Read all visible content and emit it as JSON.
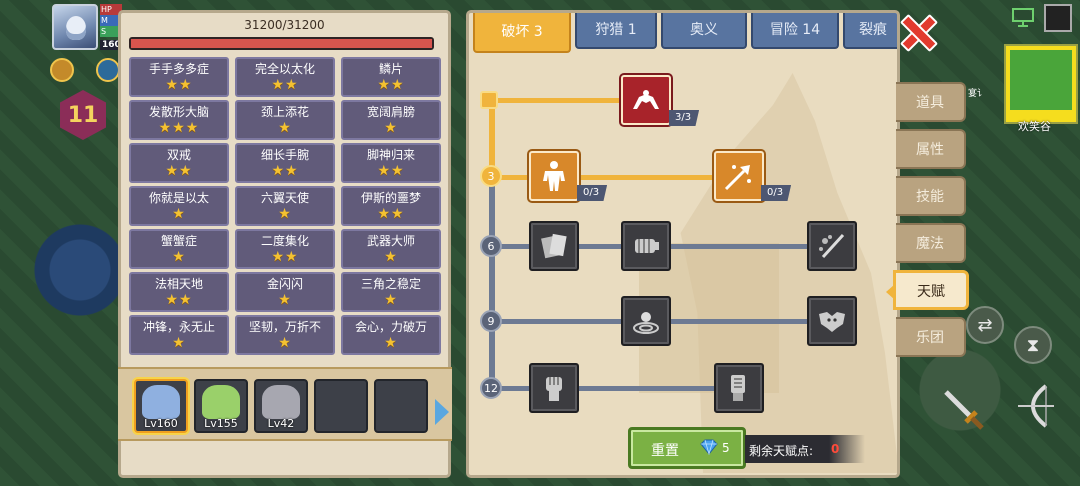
{
  "hud": {
    "bar_labels": [
      "HP",
      "M",
      "S"
    ],
    "level_tag": "160",
    "badge_number": "11"
  },
  "hero_panel": {
    "hp_text": "31200/31200",
    "hp_fraction": 1.0,
    "perks": [
      {
        "name": "手手多多症",
        "stars": 2
      },
      {
        "name": "完全以太化",
        "stars": 2
      },
      {
        "name": "鳞片",
        "stars": 2
      },
      {
        "name": "发散形大脑",
        "stars": 3
      },
      {
        "name": "颈上添花",
        "stars": 1
      },
      {
        "name": "宽阔肩膀",
        "stars": 1
      },
      {
        "name": "双戒",
        "stars": 2
      },
      {
        "name": "细长手腕",
        "stars": 2
      },
      {
        "name": "脚神归来",
        "stars": 2
      },
      {
        "name": "你就是以太",
        "stars": 1
      },
      {
        "name": "六翼天使",
        "stars": 1
      },
      {
        "name": "伊斯的噩梦",
        "stars": 2
      },
      {
        "name": "蟹蟹症",
        "stars": 1
      },
      {
        "name": "二度集化",
        "stars": 2
      },
      {
        "name": "武器大师",
        "stars": 1
      },
      {
        "name": "法相天地",
        "stars": 2
      },
      {
        "name": "金闪闪",
        "stars": 1
      },
      {
        "name": "三角之稳定",
        "stars": 1
      },
      {
        "name": "冲锋，永无止",
        "stars": 1
      },
      {
        "name": "坚韧，万折不",
        "stars": 1
      },
      {
        "name": "会心，力破万",
        "stars": 1
      }
    ],
    "heroes": [
      {
        "level": "Lv160",
        "selected": true,
        "color": "#8fb0e0"
      },
      {
        "level": "Lv155",
        "selected": false,
        "color": "#9ad06a"
      },
      {
        "level": "Lv42",
        "selected": false,
        "color": "#a7a7b0"
      },
      {
        "level": "",
        "selected": false,
        "color": ""
      },
      {
        "level": "",
        "selected": false,
        "color": ""
      }
    ]
  },
  "talent_panel": {
    "tabs": [
      {
        "label": "破坏 3",
        "active": true
      },
      {
        "label": "狩猎 1",
        "active": false
      },
      {
        "label": "奥义",
        "active": false
      },
      {
        "label": "冒险 14",
        "active": false
      },
      {
        "label": "裂痕",
        "active": false
      }
    ],
    "row_badges": [
      "3",
      "6",
      "9",
      "12"
    ],
    "nodes": {
      "arm_wrestle": {
        "count": "3/3",
        "icon": "arm-wrestle-icon"
      },
      "body": {
        "count": "0/3",
        "icon": "muscle-body-icon"
      },
      "arrow_hit": {
        "count": "0/3",
        "icon": "arrow-hit-icon"
      },
      "r6_a": {
        "icon": "cards-icon"
      },
      "r6_b": {
        "icon": "fist-punch-icon"
      },
      "r6_c": {
        "icon": "sword-splash-icon"
      },
      "r9_a": {
        "icon": "ripple-orb-icon"
      },
      "r9_b": {
        "icon": "bat-wings-icon"
      },
      "r12_a": {
        "icon": "raised-fist-icon"
      },
      "r12_b": {
        "icon": "gauntlet-icon"
      }
    },
    "reset_label": "重置",
    "reset_cost": "5",
    "remaining_label": "剩余天赋点:",
    "remaining_value": "0"
  },
  "side_menu": [
    {
      "label": "道具",
      "active": false
    },
    {
      "label": "属性",
      "active": false
    },
    {
      "label": "技能",
      "active": false
    },
    {
      "label": "魔法",
      "active": false
    },
    {
      "label": "天赋",
      "active": true
    },
    {
      "label": "乐团",
      "active": false
    }
  ],
  "map": {
    "label": "欢笑谷",
    "top_label": "宴讠"
  },
  "colors": {
    "accent": "#f0b43c",
    "tab_inactive": "#5874a0",
    "perk_bg": "#615b7a",
    "reset_green": "#7bb144",
    "danger": "#e23a2e"
  }
}
